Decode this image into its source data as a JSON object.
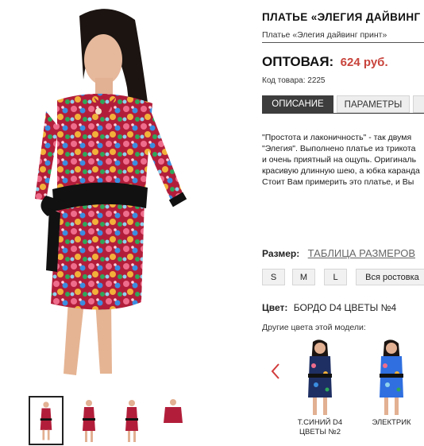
{
  "product": {
    "title": "ПЛАТЬЕ «ЭЛЕГИЯ ДАЙВИНГ ПРИНТ»",
    "breadcrumb": "Платье «Элегия дайвинг принт»",
    "price_label": "ОПТОВАЯ:",
    "price_value": "624 руб.",
    "sku": "Код товара: 2225"
  },
  "tabs": [
    {
      "label": "ОПИСАНИЕ",
      "active": true
    },
    {
      "label": "ПАРАМЕТРЫ",
      "active": false
    },
    {
      "label": "",
      "active": false
    }
  ],
  "description": {
    "lines": [
      "\"Простота и лаконичность\" - так двумя",
      "\"Элегия\". Выполнено платье из трикота",
      "и очень приятный на ощупь. Оригиналь",
      "красивую длинную шею, а юбка каранда",
      "Стоит Вам примерить это платье, и Вы"
    ]
  },
  "size": {
    "label": "Размер:",
    "table_link": "ТАБЛИЦА РАЗМЕРОВ",
    "options": [
      "S",
      "M",
      "L",
      "Вся ростовка"
    ]
  },
  "color": {
    "label": "Цвет:",
    "value": "БОРДО D4 ЦВЕТЫ №4"
  },
  "other_colors": {
    "label": "Другие цвета этой модели:",
    "variants": [
      {
        "label_line1": "Т.СИНИЙ D4",
        "label_line2": "ЦВЕТЫ №2"
      },
      {
        "label_line1": "ЭЛЕКТРИК",
        "label_line2": ""
      }
    ]
  },
  "thumbnails_count": 4,
  "colors": {
    "price": "#c8443c",
    "tab_active_bg": "#3d3d3d",
    "dress_base": "#b21e3a",
    "dress_belt": "#111111",
    "arrow": "#d23b3b"
  },
  "icons": {
    "carousel_prev": "chevron-left-icon"
  }
}
